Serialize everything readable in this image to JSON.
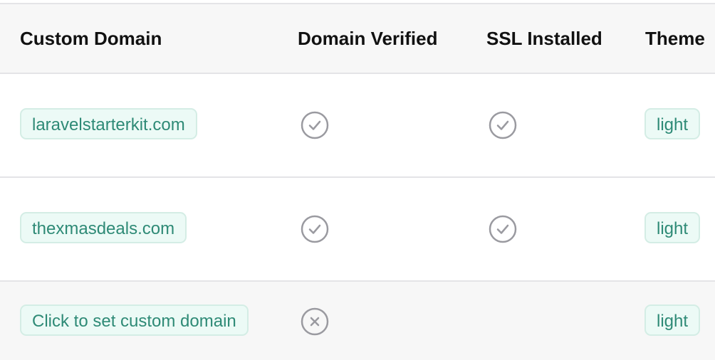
{
  "columns": {
    "custom_domain": "Custom Domain",
    "domain_verified": "Domain Verified",
    "ssl_installed": "SSL Installed",
    "theme": "Theme"
  },
  "rows": [
    {
      "domain": "laravelstarterkit.com",
      "domain_verified": "check-circle-icon",
      "ssl_installed": "check-circle-icon",
      "theme": "light"
    },
    {
      "domain": "thexmasdeals.com",
      "domain_verified": "check-circle-icon",
      "ssl_installed": "check-circle-icon",
      "theme": "light"
    },
    {
      "domain": "Click to set custom domain",
      "domain_verified": "x-circle-icon",
      "ssl_installed": "",
      "theme": "light"
    }
  ],
  "colors": {
    "chip_text": "#2e8a76",
    "chip_bg": "#ecfaf6",
    "icon_gray": "#9a9aa0",
    "header_bg": "#f7f7f7"
  }
}
